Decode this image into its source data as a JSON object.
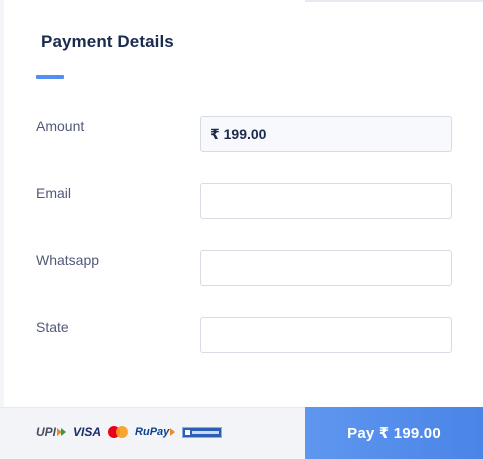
{
  "header": {
    "title": "Payment Details"
  },
  "form": {
    "amount": {
      "label": "Amount",
      "value": "₹ 199.00"
    },
    "email": {
      "label": "Email",
      "value": ""
    },
    "whatsapp": {
      "label": "Whatsapp",
      "value": ""
    },
    "state": {
      "label": "State",
      "value": ""
    }
  },
  "footer": {
    "payment_methods": {
      "upi": "UPI",
      "visa": "VISA",
      "mastercard": "mastercard-logo",
      "rupay": "RuPay",
      "bank": "bank-logo"
    },
    "pay_button_label": "Pay  ₹ 199.00"
  },
  "colors": {
    "accent": "#528ff0",
    "title": "#1b2b4d",
    "label": "#515978",
    "pay_button": "#528ff0"
  }
}
